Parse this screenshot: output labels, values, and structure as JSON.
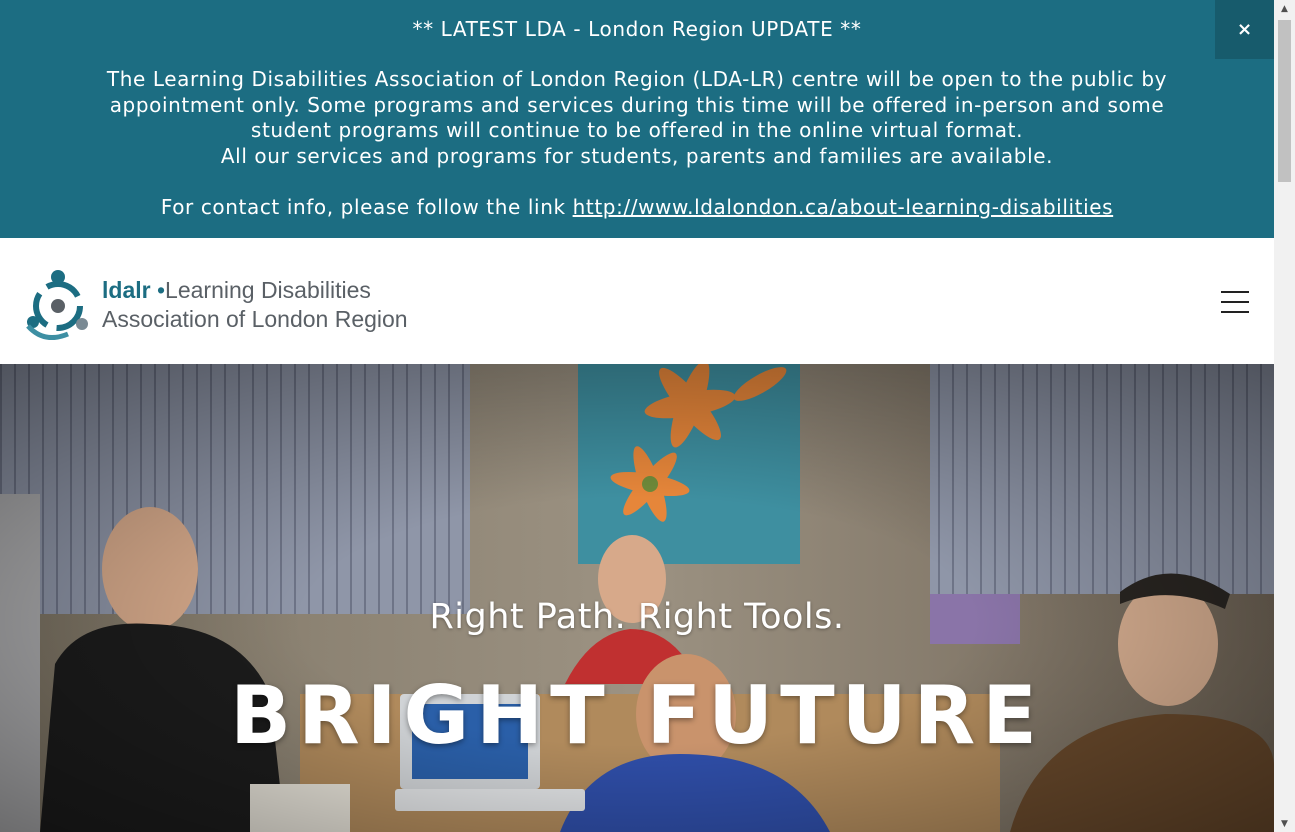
{
  "banner": {
    "title": "** LATEST LDA - London Region UPDATE **",
    "body_line1": "The Learning Disabilities Association of London Region (LDA-LR) centre will be open to the public by appointment only. Some programs and services during this time will be offered in-person and some student programs will continue to be offered in the online virtual format.",
    "body_line2": "All our services and programs for students, parents and families are available.",
    "contact_prefix": "For contact info, please follow the link ",
    "contact_link": "http://www.ldalondon.ca/about-learning-disabilities",
    "close_label": "×",
    "background_color": "#1c6d82"
  },
  "header": {
    "logo_brand": "ldalr",
    "logo_dot": "•",
    "logo_line1": "Learning Disabilities",
    "logo_line2": "Association of London Region",
    "menu_icon": "hamburger-menu-icon"
  },
  "hero": {
    "tagline": "Right Path. Right Tools.",
    "heading": "BRIGHT FUTURE"
  }
}
